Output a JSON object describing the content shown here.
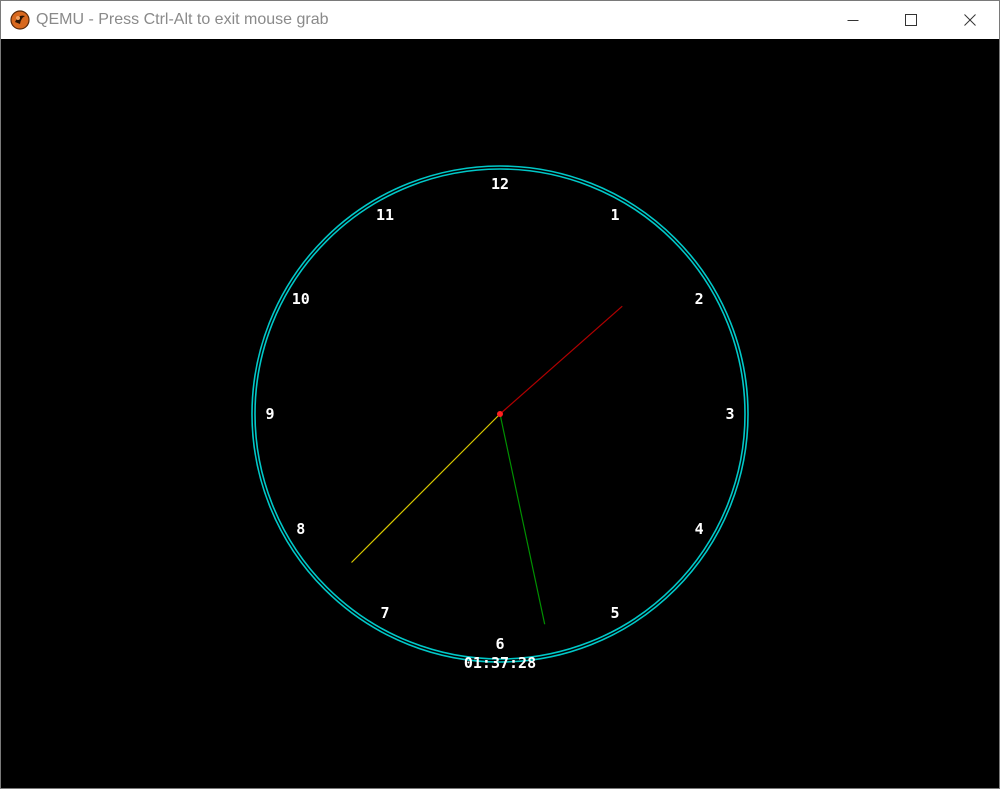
{
  "window": {
    "title": "QEMU - Press Ctrl-Alt to exit mouse grab",
    "icon": "qemu-logo-icon",
    "controls": {
      "minimize": "minimize-icon",
      "maximize": "maximize-icon",
      "close": "close-icon"
    }
  },
  "clock": {
    "numerals": [
      "12",
      "1",
      "2",
      "3",
      "4",
      "5",
      "6",
      "7",
      "8",
      "9",
      "10",
      "11"
    ],
    "time_text": "01:37:28",
    "hands": {
      "hour": 1.62,
      "minute": 37.5,
      "second": 28
    },
    "colors": {
      "background": "#000000",
      "rim": "#00c8c8",
      "hour_hand": "#b00000",
      "minute_hand": "#d8c800",
      "second_hand": "#009000",
      "center_dot": "#ff2020",
      "text": "#ffffff"
    }
  }
}
